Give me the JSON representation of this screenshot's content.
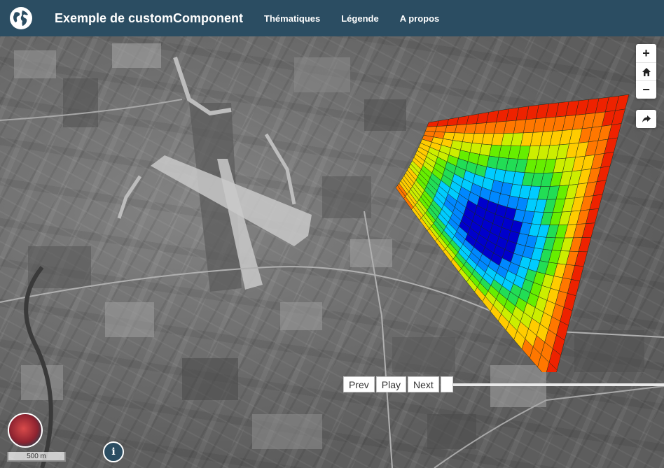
{
  "header": {
    "title": "Exemple de customComponent",
    "logo_icon": "globe-icon",
    "menu": [
      {
        "label": "Thématiques"
      },
      {
        "label": "Légende"
      },
      {
        "label": "A propos"
      }
    ]
  },
  "map": {
    "controls": {
      "zoom_in": "+",
      "home_icon": "home-icon",
      "zoom_out": "−",
      "share_icon": "share-icon"
    },
    "player": {
      "prev": "Prev",
      "play": "Play",
      "next": "Next"
    },
    "scale_label": "500 m",
    "info_label": "i"
  },
  "colors": {
    "navbar": "#2b4d62",
    "surface_palette": [
      "#0000cc",
      "#0088ff",
      "#00ccff",
      "#22dd55",
      "#66ee00",
      "#ccee00",
      "#ffcc00",
      "#ff7700",
      "#ee2200"
    ]
  }
}
